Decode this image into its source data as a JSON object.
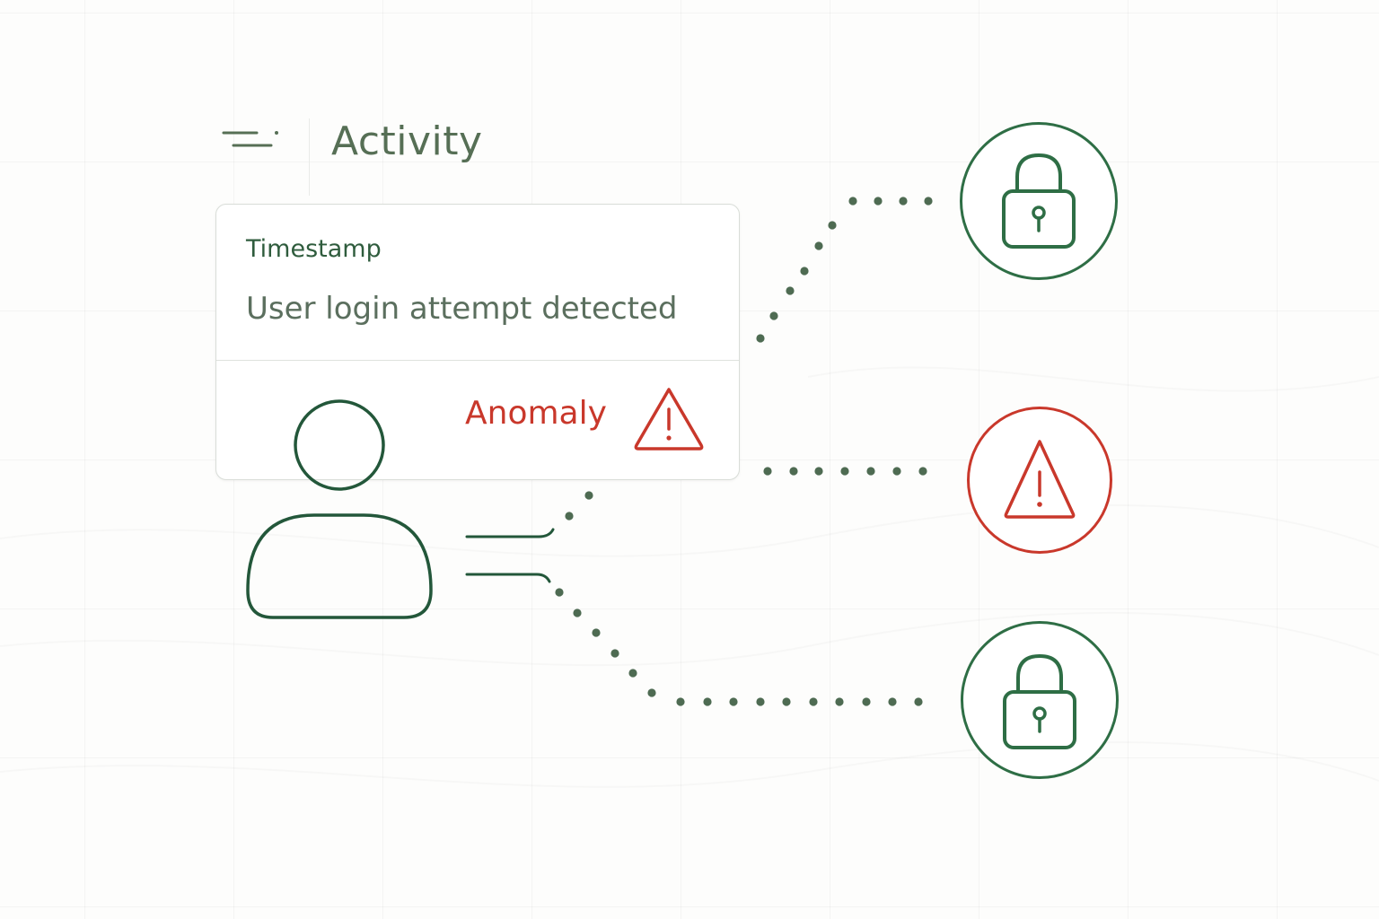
{
  "header": {
    "title": "Activity",
    "icon": "filter-lines-icon"
  },
  "event_card": {
    "label": "Timestamp",
    "message": "User login attempt detected",
    "status_label": "Anomaly",
    "status_icon": "warning-triangle-icon"
  },
  "nodes": [
    {
      "id": "secure-top",
      "icon": "lock-icon",
      "state": "secure"
    },
    {
      "id": "alert-middle",
      "icon": "warning-triangle-icon",
      "state": "alert"
    },
    {
      "id": "secure-bottom",
      "icon": "lock-icon",
      "state": "secure"
    }
  ],
  "colors": {
    "green": "#2e6e45",
    "dark_green": "#23573a",
    "dot_green": "#4e6b52",
    "red": "#c9382b",
    "muted_text": "#566f55"
  }
}
